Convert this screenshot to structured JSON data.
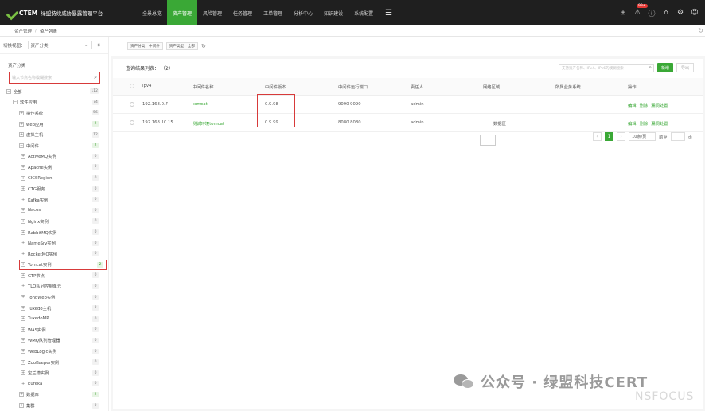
{
  "app": {
    "brand": "CTEM",
    "title": "绿盟持续威胁暴露管理平台"
  },
  "nav": [
    {
      "label": "全景总览",
      "active": false
    },
    {
      "label": "资产管理",
      "active": true
    },
    {
      "label": "风险管理",
      "active": false
    },
    {
      "label": "任务管理",
      "active": false
    },
    {
      "label": "工单管理",
      "active": false
    },
    {
      "label": "分析中心",
      "active": false
    },
    {
      "label": "知识建设",
      "active": false
    },
    {
      "label": "系统配置",
      "active": false
    }
  ],
  "top_icons": {
    "badge": "99+"
  },
  "breadcrumb": [
    "资产管理",
    "资产列表"
  ],
  "left": {
    "switch_label": "切换视图：",
    "switch_value": "资产分类",
    "tree_title": "资产分类",
    "search_placeholder": "输入节点名称模糊搜索",
    "tree": [
      {
        "label": "全部",
        "count": "112",
        "level": 0,
        "toggle": "−",
        "green": false,
        "hl": false
      },
      {
        "label": "软件应用",
        "count": "74",
        "level": 1,
        "toggle": "−",
        "green": false,
        "hl": false
      },
      {
        "label": "操作系统",
        "count": "56",
        "level": 2,
        "toggle": "+",
        "green": false,
        "hl": false
      },
      {
        "label": "web应用",
        "count": "2",
        "level": 2,
        "toggle": "+",
        "green": true,
        "hl": false
      },
      {
        "label": "虚拟主机",
        "count": "12",
        "level": 2,
        "toggle": "+",
        "green": false,
        "hl": false
      },
      {
        "label": "中间件",
        "count": "2",
        "level": 2,
        "toggle": "−",
        "green": true,
        "hl": false
      },
      {
        "label": "ActiveMQ实例",
        "count": "0",
        "level": 3,
        "toggle": "+",
        "green": false,
        "hl": false
      },
      {
        "label": "Apache实例",
        "count": "0",
        "level": 3,
        "toggle": "+",
        "green": false,
        "hl": false
      },
      {
        "label": "CICSRegion",
        "count": "0",
        "level": 3,
        "toggle": "+",
        "green": false,
        "hl": false
      },
      {
        "label": "CTG服务",
        "count": "0",
        "level": 3,
        "toggle": "+",
        "green": false,
        "hl": false
      },
      {
        "label": "Kafka实例",
        "count": "0",
        "level": 3,
        "toggle": "+",
        "green": false,
        "hl": false
      },
      {
        "label": "Nacos",
        "count": "0",
        "level": 3,
        "toggle": "+",
        "green": false,
        "hl": false
      },
      {
        "label": "Nginx实例",
        "count": "0",
        "level": 3,
        "toggle": "+",
        "green": false,
        "hl": false
      },
      {
        "label": "RabbitMQ实例",
        "count": "0",
        "level": 3,
        "toggle": "+",
        "green": false,
        "hl": false
      },
      {
        "label": "NameSrv实例",
        "count": "0",
        "level": 3,
        "toggle": "+",
        "green": false,
        "hl": false
      },
      {
        "label": "RocketMQ实例",
        "count": "0",
        "level": 3,
        "toggle": "+",
        "green": false,
        "hl": false
      },
      {
        "label": "Tomcat实例",
        "count": "2",
        "level": 3,
        "toggle": "+",
        "green": true,
        "hl": true
      },
      {
        "label": "GTP节点",
        "count": "0",
        "level": 3,
        "toggle": "+",
        "green": false,
        "hl": false
      },
      {
        "label": "TLQ队列控制单元",
        "count": "0",
        "level": 3,
        "toggle": "+",
        "green": false,
        "hl": false
      },
      {
        "label": "TongWeb实例",
        "count": "0",
        "level": 3,
        "toggle": "+",
        "green": false,
        "hl": false
      },
      {
        "label": "Tuxedo主机",
        "count": "0",
        "level": 3,
        "toggle": "+",
        "green": false,
        "hl": false
      },
      {
        "label": "TuxedoMP",
        "count": "0",
        "level": 3,
        "toggle": "+",
        "green": false,
        "hl": false
      },
      {
        "label": "WAS实例",
        "count": "0",
        "level": 3,
        "toggle": "+",
        "green": false,
        "hl": false
      },
      {
        "label": "WMQ队列管理器",
        "count": "0",
        "level": 3,
        "toggle": "+",
        "green": false,
        "hl": false
      },
      {
        "label": "WebLogic实例",
        "count": "0",
        "level": 3,
        "toggle": "+",
        "green": false,
        "hl": false
      },
      {
        "label": "ZooKeeper实例",
        "count": "0",
        "level": 3,
        "toggle": "+",
        "green": false,
        "hl": false
      },
      {
        "label": "宝兰德实例",
        "count": "0",
        "level": 3,
        "toggle": "+",
        "green": false,
        "hl": false
      },
      {
        "label": "Eureka",
        "count": "0",
        "level": 3,
        "toggle": "+",
        "green": false,
        "hl": false
      },
      {
        "label": "数据库",
        "count": "2",
        "level": 2,
        "toggle": "+",
        "green": true,
        "hl": false
      },
      {
        "label": "集群",
        "count": "0",
        "level": 2,
        "toggle": "+",
        "green": false,
        "hl": false
      }
    ]
  },
  "filters": [
    "资产分类：中间件",
    "资产类型：全部"
  ],
  "panel": {
    "title": "查询结果列表：",
    "count": "（2）",
    "search_placeholder": "支持资产名称、IPv4、IPv6的模糊搜索",
    "new_label": "新增",
    "export_label": "导出"
  },
  "table": {
    "columns": [
      "ipv4",
      "中间件名称",
      "中间件版本",
      "中间件运行端口",
      "责任人",
      "网络区域",
      "所属业务系统",
      "操作"
    ],
    "rows": [
      {
        "ipv4": "192.168.0.7",
        "name": "tomcat",
        "version": "0.9.98",
        "port": "9090 9090",
        "owner": "admin",
        "zone": "",
        "system": ""
      },
      {
        "ipv4": "192.168.10.15",
        "name": "测试环境tomcat",
        "version": "0.9.99",
        "port": "8080 8080",
        "owner": "admin",
        "zone": "数据区",
        "system": ""
      }
    ],
    "ops": [
      "编辑",
      "删除",
      "漏洞处置"
    ]
  },
  "pager": {
    "prev": "‹",
    "page": "1",
    "next": "›",
    "page_size": "10条/页",
    "goto_label": "前至",
    "page_unit": "页"
  },
  "watermark": {
    "text": "公众号 · 绿盟科技CERT",
    "sub": "NSFOCUS"
  }
}
